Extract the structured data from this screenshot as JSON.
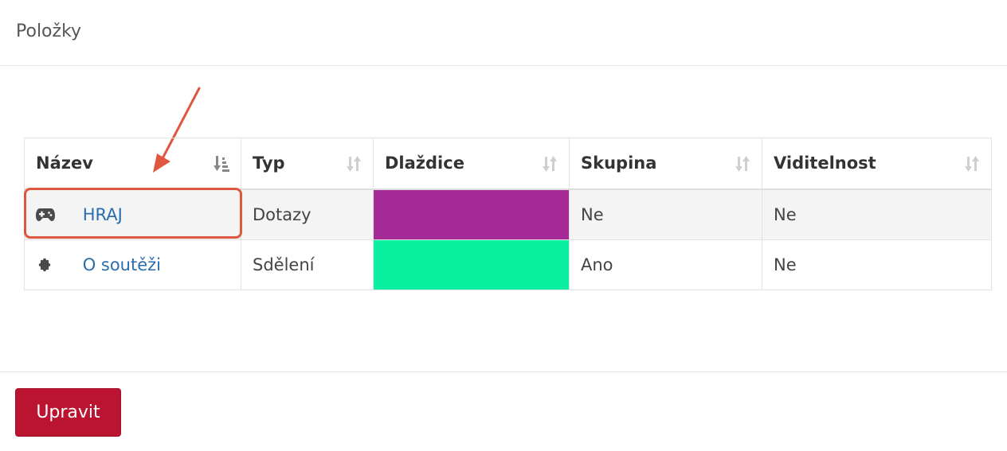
{
  "panel": {
    "title": "Položky"
  },
  "table": {
    "columns": [
      {
        "label": "Název",
        "sort": "sorted-asc"
      },
      {
        "label": "Typ",
        "sort": "sortable"
      },
      {
        "label": "Dlaždice",
        "sort": "sortable"
      },
      {
        "label": "Skupina",
        "sort": "sortable"
      },
      {
        "label": "Viditelnost",
        "sort": "sortable"
      }
    ],
    "rows": [
      {
        "icon": "gamepad-icon",
        "name": "HRAJ",
        "type": "Dotazy",
        "tile_color": "#a62b97",
        "group": "Ne",
        "visibility": "Ne"
      },
      {
        "icon": "puzzle-icon",
        "name": "O soutěži",
        "type": "Sdělení",
        "tile_color": "#0bf0a0",
        "group": "Ano",
        "visibility": "Ne"
      }
    ]
  },
  "footer": {
    "edit_label": "Upravit"
  },
  "colors": {
    "link": "#2a6db0",
    "button": "#bb1431",
    "annotation": "#e0573f"
  }
}
